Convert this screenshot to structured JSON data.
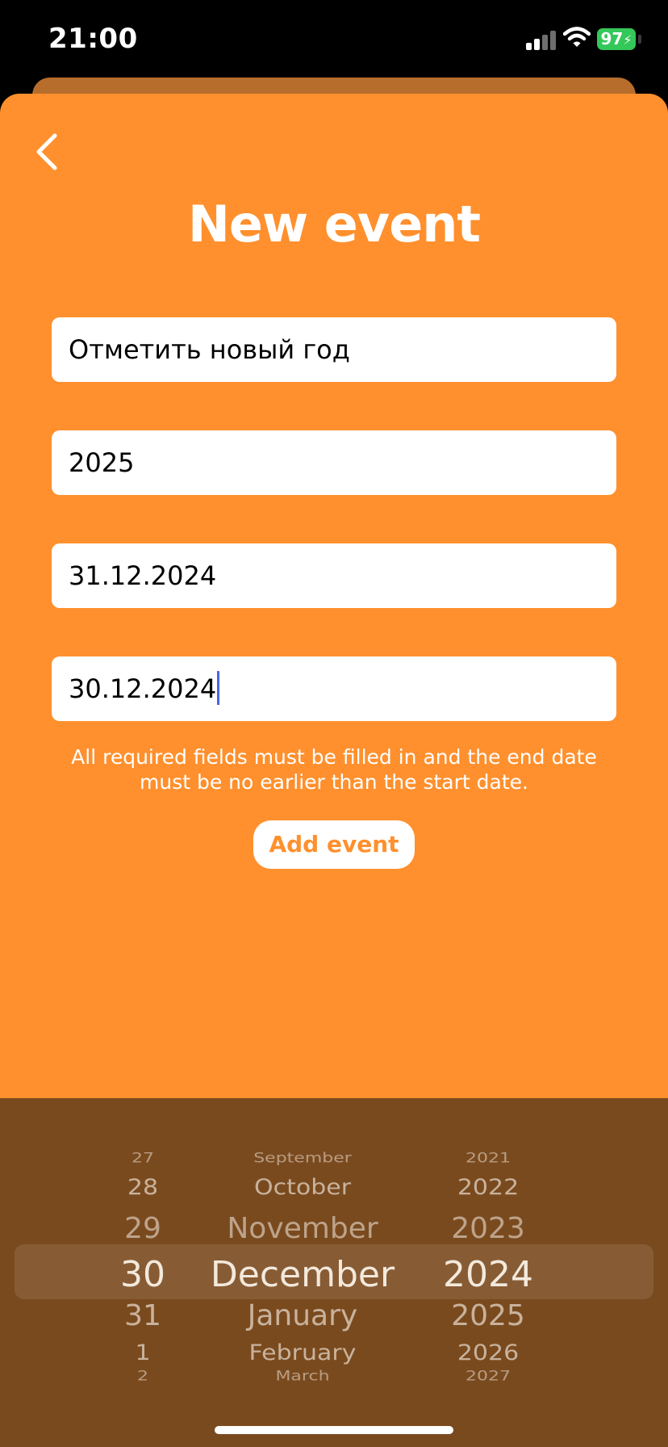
{
  "status_bar": {
    "time": "21:00",
    "battery": "97",
    "battery_color": "#34c759",
    "signal_icon": "cellular-signal-icon",
    "wifi_icon": "wifi-icon"
  },
  "header": {
    "back_icon": "chevron-left-icon",
    "title": "New event"
  },
  "form": {
    "name_value": "Отметить новый год",
    "description_value": "2025",
    "start_date_value": "31.12.2024",
    "end_date_value": "30.12.2024",
    "hint": "All required fields must be filled in and the end date must be no earlier than the start date.",
    "submit_label": "Add event"
  },
  "date_picker": {
    "days": [
      "27",
      "28",
      "29",
      "30",
      "31",
      "1",
      "2"
    ],
    "months": [
      "September",
      "October",
      "November",
      "December",
      "January",
      "February",
      "March"
    ],
    "years": [
      "2021",
      "2022",
      "2023",
      "2024",
      "2025",
      "2026",
      "2027"
    ],
    "selected_index": 3,
    "selected": {
      "day": "30",
      "month": "December",
      "year": "2024"
    }
  },
  "colors": {
    "accent": "#ff902d",
    "picker_background": "#7a4a1f",
    "caret": "#4a64e0"
  }
}
